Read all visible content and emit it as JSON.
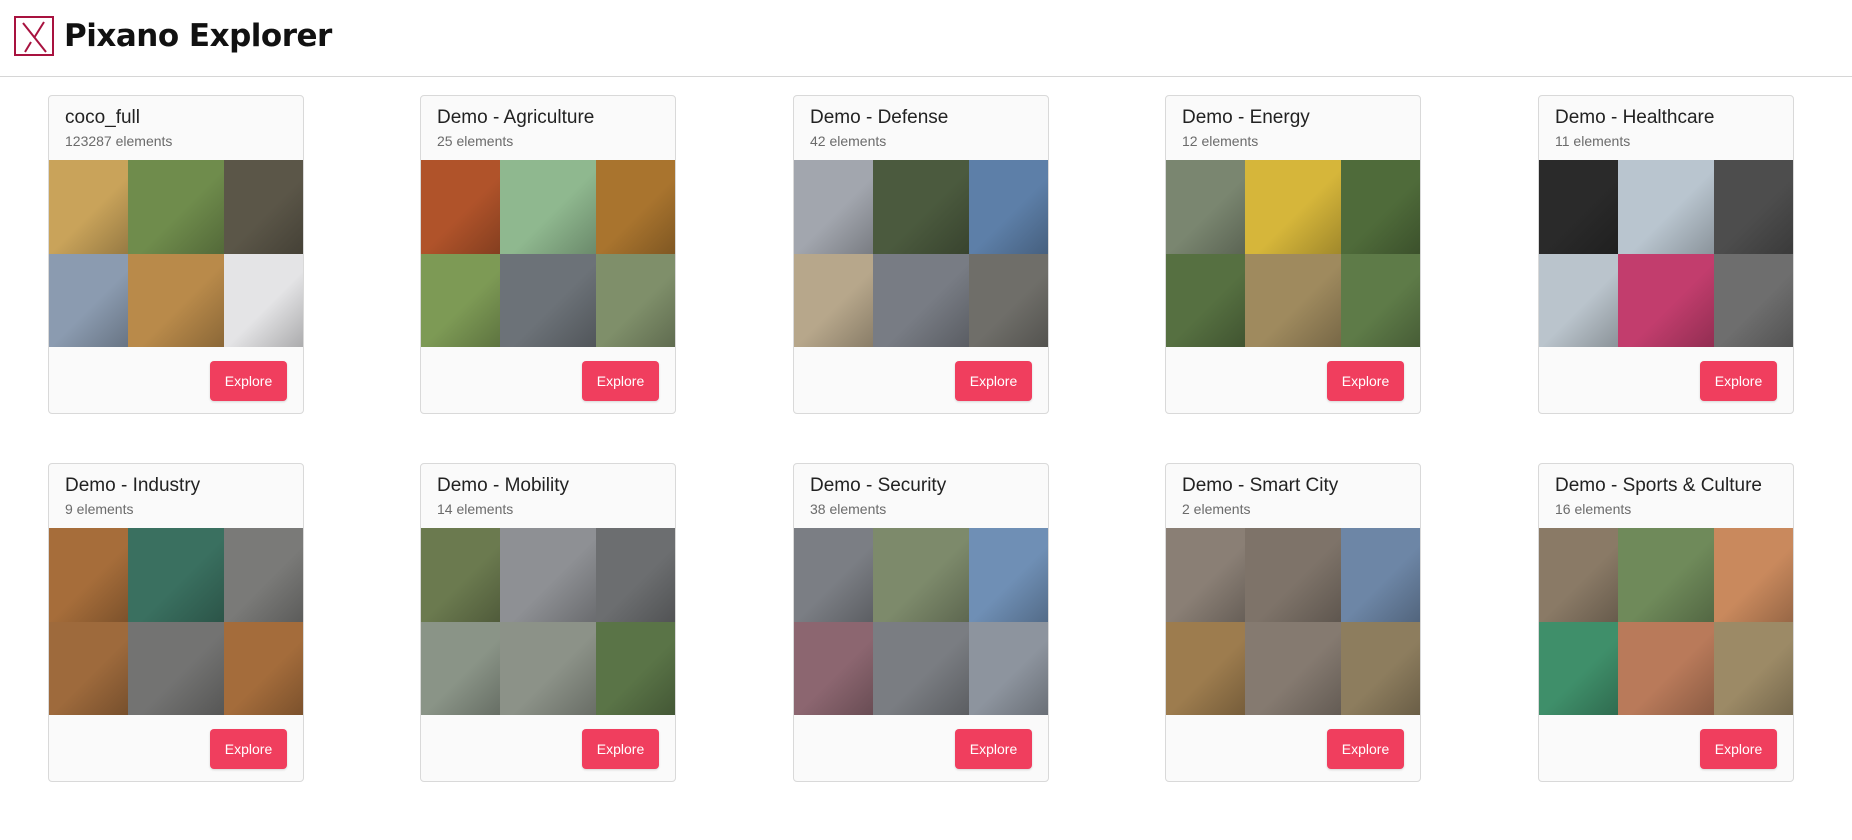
{
  "header": {
    "title": "Pixano Explorer",
    "logo_icon": "pixano-logo-icon"
  },
  "colors": {
    "accent": "#f03e5e",
    "logo": "#a8123f"
  },
  "datasets": [
    {
      "name": "coco_full",
      "count": "123287 elements",
      "explore_label": "Explore",
      "thumbs": [
        "#c9a35a",
        "#6f8c4c",
        "#5b5648",
        "#8b9bb0",
        "#b98a4a",
        "#e4e4e6"
      ]
    },
    {
      "name": "Demo - Agriculture",
      "count": "25 elements",
      "explore_label": "Explore",
      "thumbs": [
        "#b0532a",
        "#8fb88f",
        "#a9742e",
        "#7d9a55",
        "#6c7278",
        "#7f8f6a"
      ]
    },
    {
      "name": "Demo - Defense",
      "count": "42 elements",
      "explore_label": "Explore",
      "thumbs": [
        "#a2a6ae",
        "#4b5a3e",
        "#5d7fa8",
        "#b7a78b",
        "#787c84",
        "#6f6e69"
      ]
    },
    {
      "name": "Demo - Energy",
      "count": "12 elements",
      "explore_label": "Explore",
      "thumbs": [
        "#7a8670",
        "#d6b63a",
        "#4f6b3a",
        "#567041",
        "#9f8a5e",
        "#5e7b48"
      ]
    },
    {
      "name": "Demo - Healthcare",
      "count": "11 elements",
      "explore_label": "Explore",
      "thumbs": [
        "#2a2a2a",
        "#b9c5cf",
        "#4d4d4d",
        "#bac4cc",
        "#c23d6d",
        "#6e6e6e"
      ]
    },
    {
      "name": "Demo - Industry",
      "count": "9 elements",
      "explore_label": "Explore",
      "thumbs": [
        "#a66d3a",
        "#3a7060",
        "#7a7a78",
        "#9e6a3c",
        "#737372",
        "#a46c3b"
      ]
    },
    {
      "name": "Demo - Mobility",
      "count": "14 elements",
      "explore_label": "Explore",
      "thumbs": [
        "#6b7a4f",
        "#8e9094",
        "#6c6e70",
        "#8a9487",
        "#8c9288",
        "#5a7447"
      ]
    },
    {
      "name": "Demo - Security",
      "count": "38 elements",
      "explore_label": "Explore",
      "thumbs": [
        "#7b7e84",
        "#7d8a6b",
        "#6f8fb5",
        "#8c6670",
        "#7a7d82",
        "#8d949e"
      ]
    },
    {
      "name": "Demo - Smart City",
      "count": "2 elements",
      "explore_label": "Explore",
      "thumbs": [
        "#8a7f75",
        "#7e7369",
        "#6d86a6",
        "#9d7c4e",
        "#857a70",
        "#8d7d5e"
      ]
    },
    {
      "name": "Demo - Sports & Culture",
      "count": "16 elements",
      "explore_label": "Explore",
      "thumbs": [
        "#8a7a66",
        "#6f8a5a",
        "#c9895d",
        "#3f8f6a",
        "#b97a5a",
        "#9c8a66"
      ]
    }
  ]
}
